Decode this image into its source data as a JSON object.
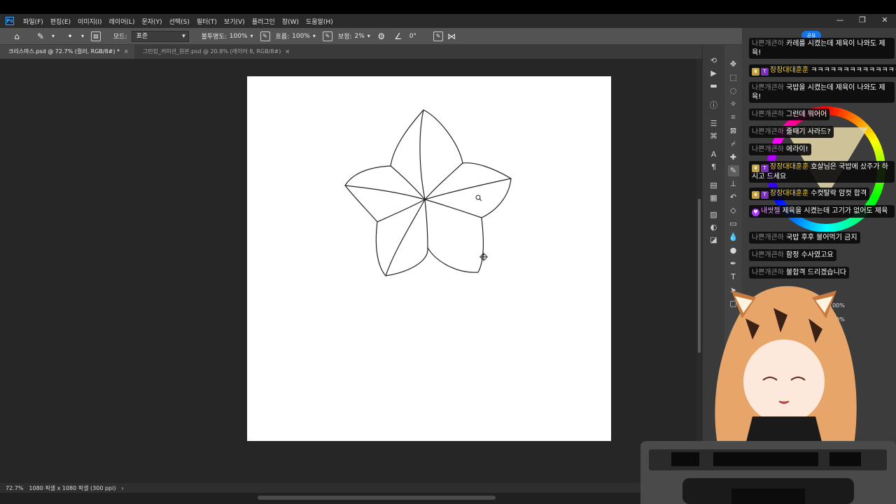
{
  "menubar": {
    "app_icon": "Ps",
    "items": [
      "파일(F)",
      "편집(E)",
      "이미지(I)",
      "레이어(L)",
      "문자(Y)",
      "선택(S)",
      "필터(T)",
      "보기(V)",
      "플러그인",
      "창(W)",
      "도움말(H)"
    ],
    "window_buttons": [
      "—",
      "❐",
      "✕"
    ]
  },
  "options": {
    "mode_label": "모드:",
    "mode_value": "표준",
    "opacity_label": "불투명도:",
    "opacity_value": "100%",
    "flow_label": "흐름:",
    "flow_value": "100%",
    "smoothing_label": "보정:",
    "smoothing_value": "2%",
    "angle_value": "0°"
  },
  "tabs": [
    {
      "label": "크리스마스.psd @ 72.7% (컬러, RGB/8#) *",
      "active": true
    },
    {
      "label": "그런킹_커미션_원본.psd @ 20.8% (레이어 8, RGB/8#)",
      "active": false
    }
  ],
  "status": {
    "zoom": "72.7%",
    "doc_info": "1080 픽셀 x 1080 픽셀 (300 ppi)"
  },
  "share_label": "공유",
  "chat": [
    {
      "user": "나쁜개큰하",
      "text": "카레를 시켰는데 제육이 나와도 제육!",
      "badges": [],
      "wrap": true
    },
    {
      "user": "장장대대훈훈",
      "text": "ㅋㅋㅋㅋㅋㅋㅋㅋㅋㅋㅋㅋㅋㅋㅋ",
      "badges": [
        "crown",
        "tier"
      ],
      "wrap": false
    },
    {
      "user": "나쁜개큰하",
      "text": "국밥을 시켰는데 제육이 나와도 제육!",
      "badges": [],
      "wrap": true
    },
    {
      "user": "나쁜개큰하",
      "text": "그런데 뭐어어",
      "badges": [],
      "wrap": false
    },
    {
      "user": "나쁜개큰하",
      "text": "줄때기 사라드?",
      "badges": [],
      "wrap": false
    },
    {
      "user": "나쁜개큰하",
      "text": "에라이!",
      "badges": [],
      "wrap": false
    },
    {
      "user": "장장대대훈훈",
      "text": "호살님은 국밥에 샀주가 하시고 드세요",
      "badges": [
        "crown",
        "tier"
      ],
      "wrap": true
    },
    {
      "user": "장장대대훈훈",
      "text": "수컷탈락 암컷 합격",
      "badges": [
        "crown",
        "tier"
      ],
      "wrap": false
    },
    {
      "user": "내쌋젤",
      "text": "제육을 시켰는데 고기가 없어도 제육",
      "badges": [
        "heart"
      ],
      "wrap": true
    },
    {
      "user": "나쁜개큰하",
      "text": "국밥 후후 불어먹기 금지",
      "badges": [],
      "wrap": false
    },
    {
      "user": "나쁜개큰하",
      "text": "함정 수사였고요",
      "badges": [],
      "wrap": false
    },
    {
      "user": "나쁜개큰하",
      "text": "불합격 드리겠습니다",
      "badges": [],
      "wrap": false
    }
  ],
  "layers_panel": {
    "opacity_value": "100%",
    "fill_value": "100%"
  }
}
